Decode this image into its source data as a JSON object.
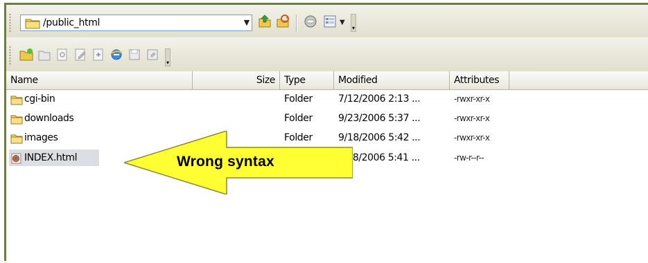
{
  "toolbar": {
    "path": "/public_html",
    "icons": [
      {
        "name": "go-up-icon"
      },
      {
        "name": "refresh-icon"
      },
      {
        "name": "stop-icon"
      },
      {
        "name": "view-mode-icon"
      }
    ]
  },
  "toolbar2": {
    "icons": [
      "new-folder-icon",
      "delete-icon",
      "view-icon",
      "edit-icon",
      "properties-icon",
      "browser-icon",
      "save-icon",
      "save-as-icon"
    ]
  },
  "columns": {
    "name": "Name",
    "size": "Size",
    "type": "Type",
    "modified": "Modified",
    "attributes": "Attributes"
  },
  "files": [
    {
      "name": "cgi-bin",
      "type": "Folder",
      "modified": "7/12/2006 2:13 ...",
      "attributes": "-rwxr-xr-x",
      "icon": "folder-icon"
    },
    {
      "name": "downloads",
      "type": "Folder",
      "modified": "9/23/2006 5:37 ...",
      "attributes": "-rwxr-xr-x",
      "icon": "folder-icon"
    },
    {
      "name": "images",
      "type": "Folder",
      "modified": "9/18/2006 5:42 ...",
      "attributes": "-rwxr-xr-x",
      "icon": "folder-icon"
    },
    {
      "name": "INDEX.html",
      "type": "",
      "modified": "/18/2006 5:41 ...",
      "attributes": "-rw-r--r--",
      "icon": "html-file-icon"
    }
  ],
  "annotation": {
    "text": "Wrong syntax",
    "color": "#ffff33"
  }
}
